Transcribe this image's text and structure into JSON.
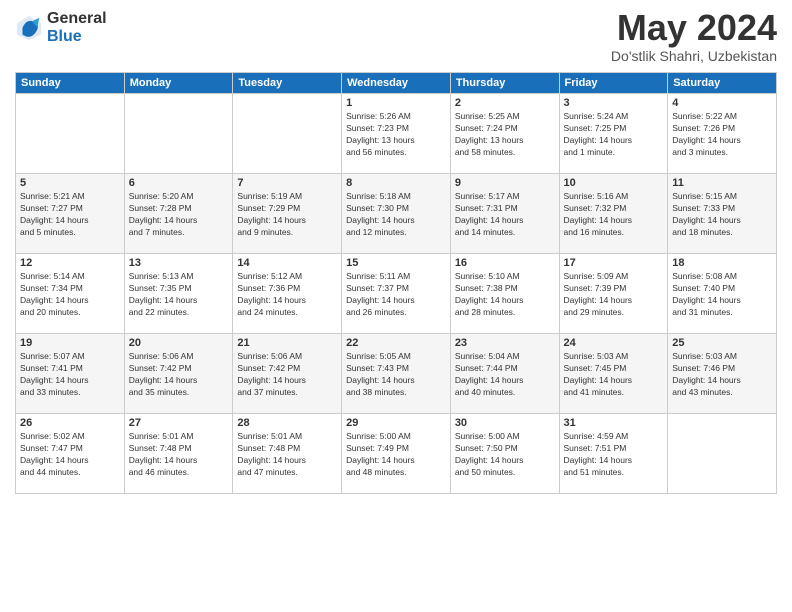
{
  "logo": {
    "general": "General",
    "blue": "Blue"
  },
  "title": {
    "month_year": "May 2024",
    "location": "Do'stlik Shahri, Uzbekistan"
  },
  "headers": [
    "Sunday",
    "Monday",
    "Tuesday",
    "Wednesday",
    "Thursday",
    "Friday",
    "Saturday"
  ],
  "weeks": [
    [
      {
        "day": "",
        "info": ""
      },
      {
        "day": "",
        "info": ""
      },
      {
        "day": "",
        "info": ""
      },
      {
        "day": "1",
        "info": "Sunrise: 5:26 AM\nSunset: 7:23 PM\nDaylight: 13 hours\nand 56 minutes."
      },
      {
        "day": "2",
        "info": "Sunrise: 5:25 AM\nSunset: 7:24 PM\nDaylight: 13 hours\nand 58 minutes."
      },
      {
        "day": "3",
        "info": "Sunrise: 5:24 AM\nSunset: 7:25 PM\nDaylight: 14 hours\nand 1 minute."
      },
      {
        "day": "4",
        "info": "Sunrise: 5:22 AM\nSunset: 7:26 PM\nDaylight: 14 hours\nand 3 minutes."
      }
    ],
    [
      {
        "day": "5",
        "info": "Sunrise: 5:21 AM\nSunset: 7:27 PM\nDaylight: 14 hours\nand 5 minutes."
      },
      {
        "day": "6",
        "info": "Sunrise: 5:20 AM\nSunset: 7:28 PM\nDaylight: 14 hours\nand 7 minutes."
      },
      {
        "day": "7",
        "info": "Sunrise: 5:19 AM\nSunset: 7:29 PM\nDaylight: 14 hours\nand 9 minutes."
      },
      {
        "day": "8",
        "info": "Sunrise: 5:18 AM\nSunset: 7:30 PM\nDaylight: 14 hours\nand 12 minutes."
      },
      {
        "day": "9",
        "info": "Sunrise: 5:17 AM\nSunset: 7:31 PM\nDaylight: 14 hours\nand 14 minutes."
      },
      {
        "day": "10",
        "info": "Sunrise: 5:16 AM\nSunset: 7:32 PM\nDaylight: 14 hours\nand 16 minutes."
      },
      {
        "day": "11",
        "info": "Sunrise: 5:15 AM\nSunset: 7:33 PM\nDaylight: 14 hours\nand 18 minutes."
      }
    ],
    [
      {
        "day": "12",
        "info": "Sunrise: 5:14 AM\nSunset: 7:34 PM\nDaylight: 14 hours\nand 20 minutes."
      },
      {
        "day": "13",
        "info": "Sunrise: 5:13 AM\nSunset: 7:35 PM\nDaylight: 14 hours\nand 22 minutes."
      },
      {
        "day": "14",
        "info": "Sunrise: 5:12 AM\nSunset: 7:36 PM\nDaylight: 14 hours\nand 24 minutes."
      },
      {
        "day": "15",
        "info": "Sunrise: 5:11 AM\nSunset: 7:37 PM\nDaylight: 14 hours\nand 26 minutes."
      },
      {
        "day": "16",
        "info": "Sunrise: 5:10 AM\nSunset: 7:38 PM\nDaylight: 14 hours\nand 28 minutes."
      },
      {
        "day": "17",
        "info": "Sunrise: 5:09 AM\nSunset: 7:39 PM\nDaylight: 14 hours\nand 29 minutes."
      },
      {
        "day": "18",
        "info": "Sunrise: 5:08 AM\nSunset: 7:40 PM\nDaylight: 14 hours\nand 31 minutes."
      }
    ],
    [
      {
        "day": "19",
        "info": "Sunrise: 5:07 AM\nSunset: 7:41 PM\nDaylight: 14 hours\nand 33 minutes."
      },
      {
        "day": "20",
        "info": "Sunrise: 5:06 AM\nSunset: 7:42 PM\nDaylight: 14 hours\nand 35 minutes."
      },
      {
        "day": "21",
        "info": "Sunrise: 5:06 AM\nSunset: 7:42 PM\nDaylight: 14 hours\nand 37 minutes."
      },
      {
        "day": "22",
        "info": "Sunrise: 5:05 AM\nSunset: 7:43 PM\nDaylight: 14 hours\nand 38 minutes."
      },
      {
        "day": "23",
        "info": "Sunrise: 5:04 AM\nSunset: 7:44 PM\nDaylight: 14 hours\nand 40 minutes."
      },
      {
        "day": "24",
        "info": "Sunrise: 5:03 AM\nSunset: 7:45 PM\nDaylight: 14 hours\nand 41 minutes."
      },
      {
        "day": "25",
        "info": "Sunrise: 5:03 AM\nSunset: 7:46 PM\nDaylight: 14 hours\nand 43 minutes."
      }
    ],
    [
      {
        "day": "26",
        "info": "Sunrise: 5:02 AM\nSunset: 7:47 PM\nDaylight: 14 hours\nand 44 minutes."
      },
      {
        "day": "27",
        "info": "Sunrise: 5:01 AM\nSunset: 7:48 PM\nDaylight: 14 hours\nand 46 minutes."
      },
      {
        "day": "28",
        "info": "Sunrise: 5:01 AM\nSunset: 7:48 PM\nDaylight: 14 hours\nand 47 minutes."
      },
      {
        "day": "29",
        "info": "Sunrise: 5:00 AM\nSunset: 7:49 PM\nDaylight: 14 hours\nand 48 minutes."
      },
      {
        "day": "30",
        "info": "Sunrise: 5:00 AM\nSunset: 7:50 PM\nDaylight: 14 hours\nand 50 minutes."
      },
      {
        "day": "31",
        "info": "Sunrise: 4:59 AM\nSunset: 7:51 PM\nDaylight: 14 hours\nand 51 minutes."
      },
      {
        "day": "",
        "info": ""
      }
    ]
  ]
}
